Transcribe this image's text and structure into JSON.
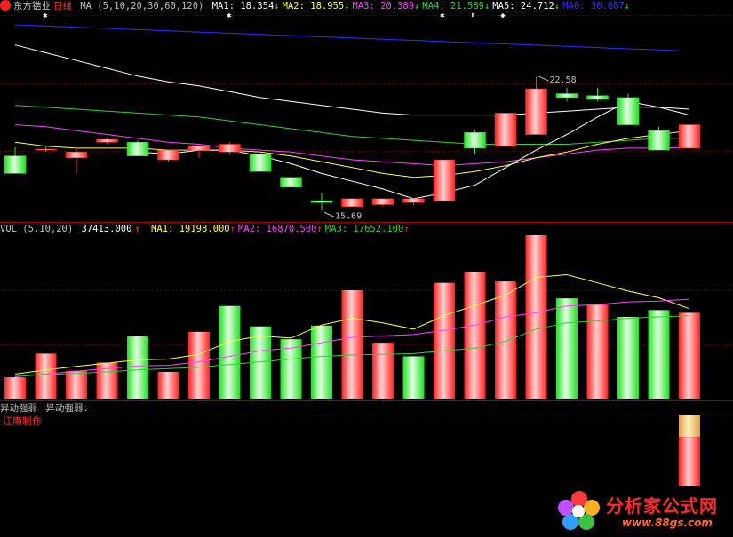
{
  "colors": {
    "bg": "#000000",
    "up": "#ff3030",
    "down": "#30e030",
    "text": "#c0c0c0",
    "ma1": "#ffffff",
    "ma2": "#ffff40",
    "ma3": "#ff40ff",
    "ma4": "#30d030",
    "ma5": "#ffffff",
    "ma6": "#3030ff",
    "grid": "#7a0000"
  },
  "price_header": {
    "stock_name": "东方锆业",
    "period": "日线",
    "ma_label": "MA (5,10,20,30,60,120)",
    "items": [
      {
        "label": "MA1:",
        "value": "18.354",
        "arrow": "↓",
        "color": "#ffffff"
      },
      {
        "label": "MA2:",
        "value": "18.955",
        "arrow": "↓",
        "color": "#ffff40"
      },
      {
        "label": "MA3:",
        "value": "20.389",
        "arrow": "↓",
        "color": "#ff40ff"
      },
      {
        "label": "MA4:",
        "value": "21.589",
        "arrow": "↓",
        "color": "#30d030"
      },
      {
        "label": "MA5:",
        "value": "24.712",
        "arrow": "↓",
        "color": "#ffffff"
      },
      {
        "label": "MA6:",
        "value": "30.087",
        "arrow": "↓",
        "color": "#3030ff"
      }
    ]
  },
  "volume_header": {
    "label": "VOL (5,10,20)",
    "value": "37413.000",
    "arrow": "↑",
    "items": [
      {
        "label": "MA1:",
        "value": "19198.000",
        "arrow": "↑",
        "color": "#ffff40"
      },
      {
        "label": "MA2:",
        "value": "16870.500",
        "arrow": "↑",
        "color": "#ff40ff"
      },
      {
        "label": "MA3:",
        "value": "17652.100",
        "arrow": "↑",
        "color": "#30d030"
      }
    ]
  },
  "indicator_header": {
    "label": "异动强弱",
    "label2": "异动强弱:"
  },
  "credit_text": "江南制作",
  "watermark": {
    "name": "分析家公式网",
    "url": "www.88gs.com"
  },
  "chart_data": [
    {
      "type": "candlestick",
      "annotations": [
        {
          "text": "22.58",
          "index": 17,
          "value": 22.58
        },
        {
          "text": "15.69",
          "index": 10,
          "value": 15.69
        }
      ],
      "y_range": [
        15.2,
        25.6
      ],
      "candles": [
        {
          "o": 18.5,
          "h": 18.95,
          "c": 17.6,
          "l": 17.6
        },
        {
          "o": 18.8,
          "h": 19.0,
          "c": 18.85,
          "l": 18.7
        },
        {
          "o": 18.4,
          "h": 18.9,
          "c": 18.7,
          "l": 17.6
        },
        {
          "o": 19.2,
          "h": 19.4,
          "c": 19.35,
          "l": 19.1
        },
        {
          "o": 19.2,
          "h": 19.3,
          "c": 18.5,
          "l": 18.5
        },
        {
          "o": 18.3,
          "h": 18.8,
          "c": 18.8,
          "l": 18.2
        },
        {
          "o": 18.8,
          "h": 19.0,
          "c": 19.0,
          "l": 18.4
        },
        {
          "o": 18.7,
          "h": 19.2,
          "c": 19.1,
          "l": 18.6
        },
        {
          "o": 18.6,
          "h": 18.6,
          "c": 17.7,
          "l": 17.7
        },
        {
          "o": 17.4,
          "h": 17.4,
          "c": 16.9,
          "l": 16.9
        },
        {
          "o": 16.2,
          "h": 16.6,
          "c": 16.1,
          "l": 15.69
        },
        {
          "o": 15.9,
          "h": 16.3,
          "c": 16.3,
          "l": 15.9
        },
        {
          "o": 16.0,
          "h": 16.3,
          "c": 16.3,
          "l": 15.9
        },
        {
          "o": 16.1,
          "h": 16.3,
          "c": 16.3,
          "l": 15.95
        },
        {
          "o": 16.2,
          "h": 18.3,
          "c": 18.3,
          "l": 16.2
        },
        {
          "o": 19.7,
          "h": 19.8,
          "c": 18.9,
          "l": 18.6
        },
        {
          "o": 19.0,
          "h": 20.7,
          "c": 20.7,
          "l": 19.0
        },
        {
          "o": 19.6,
          "h": 22.58,
          "c": 21.95,
          "l": 19.6
        },
        {
          "o": 21.7,
          "h": 22.0,
          "c": 21.5,
          "l": 21.3
        },
        {
          "o": 21.6,
          "h": 22.0,
          "c": 21.4,
          "l": 21.3
        },
        {
          "o": 21.5,
          "h": 21.7,
          "c": 20.1,
          "l": 20.1
        },
        {
          "o": 19.8,
          "h": 20.0,
          "c": 18.8,
          "l": 18.8
        },
        {
          "o": 18.9,
          "h": 20.1,
          "c": 20.1,
          "l": 18.9
        }
      ],
      "series": [
        {
          "name": "MA1",
          "color": "#ffffff",
          "values": [
            null,
            null,
            null,
            null,
            18.7,
            18.6,
            18.8,
            18.8,
            18.5,
            18.1,
            17.6,
            17.2,
            16.8,
            16.3,
            16.6,
            17.0,
            17.9,
            18.8,
            19.6,
            20.5,
            21.3,
            21.0,
            20.6
          ]
        },
        {
          "name": "MA2",
          "color": "#ffff40",
          "values": [
            19.2,
            19.0,
            18.9,
            18.9,
            18.9,
            18.8,
            18.8,
            18.8,
            18.7,
            18.5,
            18.2,
            17.9,
            17.6,
            17.4,
            17.5,
            17.7,
            18.0,
            18.4,
            18.7,
            19.1,
            19.4,
            19.6,
            19.8
          ]
        },
        {
          "name": "MA3",
          "color": "#ff40ff",
          "values": [
            20.1,
            20.0,
            19.8,
            19.6,
            19.4,
            19.2,
            19.1,
            18.9,
            18.8,
            18.7,
            18.5,
            18.3,
            18.2,
            18.1,
            18.0,
            18.1,
            18.2,
            18.4,
            18.6,
            18.8,
            18.9,
            18.9,
            18.95
          ]
        },
        {
          "name": "MA4",
          "color": "#30d030",
          "values": [
            21.1,
            21.0,
            20.9,
            20.8,
            20.7,
            20.6,
            20.5,
            20.3,
            20.1,
            19.9,
            19.7,
            19.5,
            19.4,
            19.3,
            19.2,
            19.1,
            19.1,
            19.1,
            19.1,
            19.2,
            19.3,
            19.4,
            19.4
          ]
        },
        {
          "name": "MA5",
          "color": "#ffffff",
          "values": [
            24.2,
            23.8,
            23.4,
            23.0,
            22.6,
            22.3,
            22.1,
            21.8,
            21.5,
            21.3,
            21.1,
            20.9,
            20.7,
            20.6,
            20.6,
            20.6,
            20.6,
            20.7,
            20.8,
            20.9,
            21.0,
            21.0,
            20.9
          ]
        },
        {
          "name": "MA6",
          "color": "#3030ff",
          "values": [
            30.9,
            30.85,
            30.8,
            30.75,
            30.7,
            30.65,
            30.6,
            30.55,
            30.5,
            30.45,
            30.4,
            30.35,
            30.3,
            30.25,
            30.2,
            30.15,
            30.1,
            30.05,
            30.0,
            29.95,
            29.9,
            29.85,
            29.8
          ]
        }
      ]
    },
    {
      "type": "bar",
      "y_range": [
        0,
        60000
      ],
      "volumes": [
        7800,
        16500,
        10200,
        13200,
        22800,
        9800,
        24500,
        34000,
        26500,
        21800,
        26800,
        39800,
        20500,
        15500,
        42500,
        46500,
        43000,
        60000,
        36800,
        34500,
        30000,
        32500,
        31500
      ],
      "up": [
        true,
        true,
        true,
        true,
        false,
        true,
        true,
        false,
        false,
        false,
        false,
        true,
        true,
        false,
        true,
        true,
        true,
        true,
        false,
        true,
        false,
        false,
        true
      ],
      "series": [
        {
          "name": "MA1",
          "color": "#ffff40",
          "values": [
            9000,
            10500,
            11800,
            13000,
            14200,
            14500,
            16200,
            21000,
            23000,
            22200,
            27000,
            29500,
            27800,
            25500,
            30500,
            34200,
            38000,
            44500,
            45500,
            42500,
            39500,
            37000,
            33000
          ]
        },
        {
          "name": "MA2",
          "color": "#ff40ff",
          "values": [
            8000,
            9000,
            10000,
            11000,
            12000,
            12200,
            13500,
            15500,
            17500,
            18500,
            20500,
            22500,
            23000,
            23500,
            25000,
            27000,
            30000,
            31500,
            34000,
            34500,
            35500,
            35800,
            36500
          ]
        },
        {
          "name": "MA3",
          "color": "#30d030",
          "values": [
            8500,
            8800,
            9200,
            9800,
            10500,
            11000,
            11500,
            12500,
            13500,
            14500,
            15500,
            16000,
            16200,
            16500,
            17500,
            18500,
            21000,
            25500,
            27800,
            28500,
            29500,
            30000,
            30500
          ]
        }
      ]
    },
    {
      "type": "bar",
      "y_range": [
        0,
        1
      ],
      "bars": [
        {
          "index": 22,
          "value": 1.0,
          "top_fraction": 0.31
        }
      ]
    }
  ]
}
